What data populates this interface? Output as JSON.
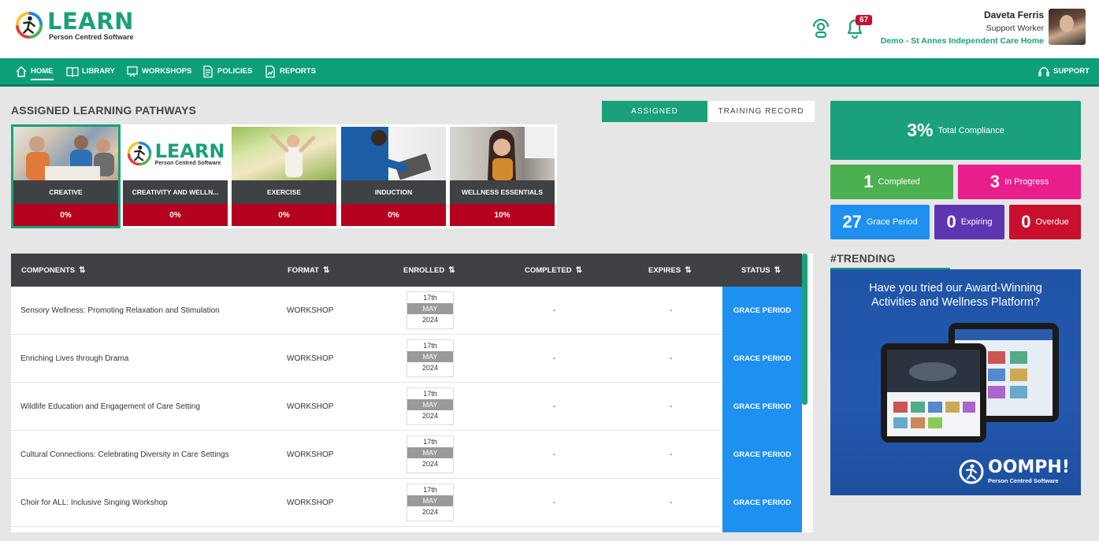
{
  "brand": {
    "title": "LEARN",
    "subtitle": "Person Centred Software"
  },
  "header": {
    "notifications_count": "67",
    "user_name": "Daveta Ferris",
    "user_role": "Support Worker",
    "user_home": "Demo - St Annes Independent Care Home"
  },
  "nav": {
    "items": [
      "HOME",
      "LIBRARY",
      "WORKSHOPS",
      "POLICIES",
      "REPORTS"
    ],
    "support": "SUPPORT"
  },
  "pathways": {
    "title": "ASSIGNED LEARNING PATHWAYS",
    "toggle": [
      "ASSIGNED",
      "TRAINING RECORD"
    ],
    "cards": [
      {
        "label": "CREATIVE",
        "pct": "0%"
      },
      {
        "label": "CREATIVITY AND WELLN...",
        "pct": "0%"
      },
      {
        "label": "EXERCISE",
        "pct": "0%"
      },
      {
        "label": "INDUCTION",
        "pct": "0%"
      },
      {
        "label": "WELLNESS ESSENTIALS",
        "pct": "10%"
      }
    ]
  },
  "table": {
    "headers": [
      "COMPONENTS",
      "FORMAT",
      "ENROLLED",
      "COMPLETED",
      "EXPIRES",
      "STATUS"
    ],
    "rows": [
      {
        "component": "Sensory Wellness: Promoting Relaxation and Stimulation",
        "format": "WORKSHOP",
        "day": "17th",
        "month": "MAY",
        "year": "2024",
        "completed": "-",
        "expires": "-",
        "status": "GRACE PERIOD"
      },
      {
        "component": "Enriching Lives through Drama",
        "format": "WORKSHOP",
        "day": "17th",
        "month": "MAY",
        "year": "2024",
        "completed": "-",
        "expires": "-",
        "status": "GRACE PERIOD"
      },
      {
        "component": "Wildlife Education and Engagement of Care Setting",
        "format": "WORKSHOP",
        "day": "17th",
        "month": "MAY",
        "year": "2024",
        "completed": "-",
        "expires": "-",
        "status": "GRACE PERIOD"
      },
      {
        "component": "Cultural Connections: Celebrating Diversity in Care Settings",
        "format": "WORKSHOP",
        "day": "17th",
        "month": "MAY",
        "year": "2024",
        "completed": "-",
        "expires": "-",
        "status": "GRACE PERIOD"
      },
      {
        "component": "Choir for ALL: Inclusive Singing Workshop",
        "format": "WORKSHOP",
        "day": "17th",
        "month": "MAY",
        "year": "2024",
        "completed": "-",
        "expires": "-",
        "status": "GRACE PERIOD"
      }
    ]
  },
  "compliance": {
    "total": {
      "value": "3%",
      "label": "Total Compliance",
      "color": "#1aa07a"
    },
    "completed": {
      "value": "1",
      "label": "Completed",
      "color": "#4caf50"
    },
    "in_progress": {
      "value": "3",
      "label": "In Progress",
      "color": "#e91e8c"
    },
    "grace": {
      "value": "27",
      "label": "Grace Period",
      "color": "#1e90f0"
    },
    "expiring": {
      "value": "0",
      "label": "Expiring",
      "color": "#5e35b1"
    },
    "overdue": {
      "value": "0",
      "label": "Overdue",
      "color": "#c8102e"
    }
  },
  "trending": {
    "title": "#TRENDING",
    "promo_line1": "Have you tried our Award-Winning",
    "promo_line2": "Activities and Wellness Platform?",
    "promo_brand": "OOMPH!",
    "promo_sub": "Person Centred Software"
  }
}
